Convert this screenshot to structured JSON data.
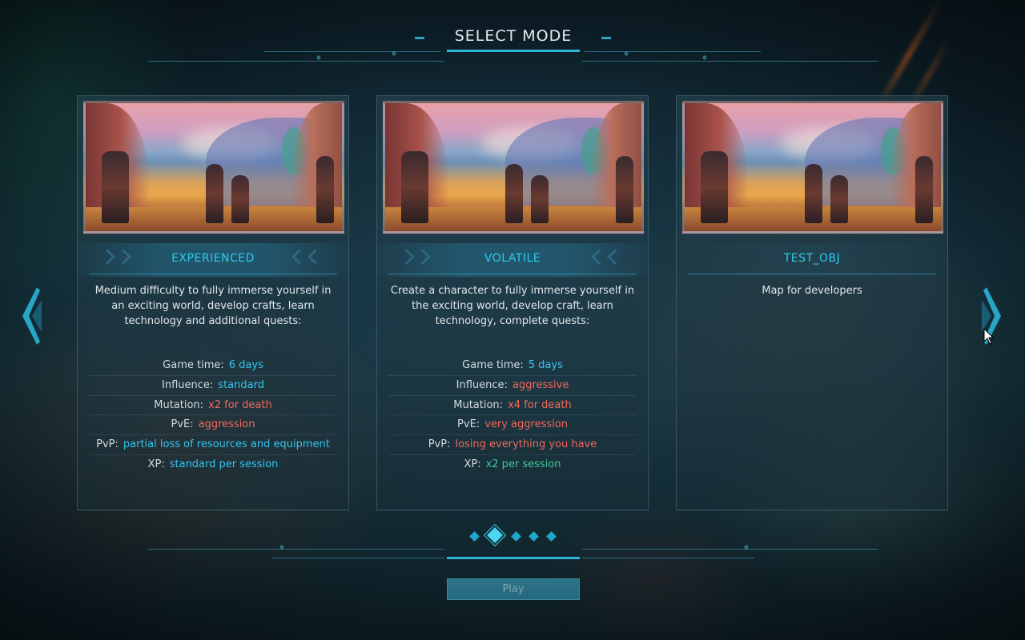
{
  "header": {
    "title": "SELECT MODE"
  },
  "modes": [
    {
      "name": "EXPERIENCED",
      "description": "Medium difficulty to fully immerse yourself in an exciting world, develop crafts, learn technology and additional quests:",
      "stats": [
        {
          "label": "Game time:",
          "value": "6 days",
          "color": "blue"
        },
        {
          "label": "Influence:",
          "value": "standard",
          "color": "blue"
        },
        {
          "label": "Mutation:",
          "value": "x2 for death",
          "color": "red"
        },
        {
          "label": "PvE:",
          "value": "aggression",
          "color": "red"
        },
        {
          "label": "PvP:",
          "value": "partial loss of resources and equipment",
          "color": "blue"
        },
        {
          "label": "XP:",
          "value": "standard per session",
          "color": "blue"
        }
      ]
    },
    {
      "name": "VOLATILE",
      "description": "Create a character to fully immerse yourself in the exciting world, develop craft, learn technology, complete quests:",
      "stats": [
        {
          "label": "Game time:",
          "value": "5 days",
          "color": "blue"
        },
        {
          "label": "Influence:",
          "value": "aggressive",
          "color": "red"
        },
        {
          "label": "Mutation:",
          "value": "x4 for death",
          "color": "red"
        },
        {
          "label": "PvE:",
          "value": "very aggression",
          "color": "red"
        },
        {
          "label": "PvP:",
          "value": "losing everything you have",
          "color": "red"
        },
        {
          "label": "XP:",
          "value": "x2 per session",
          "color": "green"
        }
      ]
    },
    {
      "name": "TEST_OBJ",
      "description": "Map for developers",
      "stats": []
    }
  ],
  "pager": {
    "count": 5,
    "active_index": 1
  },
  "footer": {
    "play_label": "Play"
  },
  "colors": {
    "accent": "#2bb6d8",
    "blue": "#35c4ee",
    "red": "#f2685a",
    "green": "#3ec79a"
  },
  "icons": {
    "prev": "chevron-left-icon",
    "next": "chevron-right-icon"
  }
}
